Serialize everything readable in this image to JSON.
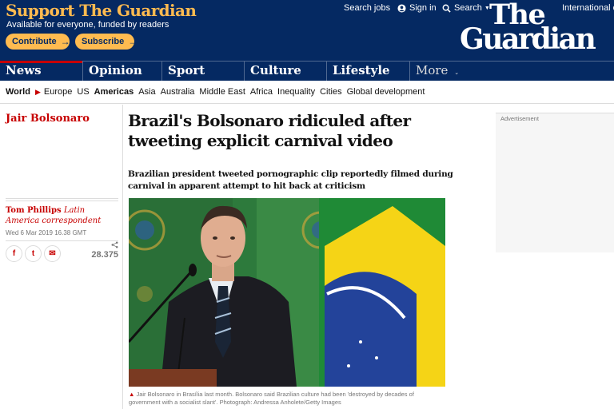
{
  "banner": {
    "title": "Support The Guardian",
    "subtitle": "Available for everyone, funded by readers",
    "contribute_label": "Contribute",
    "subscribe_label": "Subscribe",
    "arrow": "→"
  },
  "toplinks": {
    "jobs": "Search jobs",
    "signin": "Sign in",
    "search": "Search",
    "edition": "International e"
  },
  "logo": {
    "line1": "The",
    "line2": "Guardian"
  },
  "pillars": [
    "News",
    "Opinion",
    "Sport",
    "Culture",
    "Lifestyle",
    "More"
  ],
  "subnav": [
    "World",
    "Europe",
    "US",
    "Americas",
    "Asia",
    "Australia",
    "Middle East",
    "Africa",
    "Inequality",
    "Cities",
    "Global development"
  ],
  "article": {
    "series": "Jair Bolsonaro",
    "author_name": "Tom Phillips",
    "author_role": "Latin America correspondent",
    "date": "Wed 6 Mar 2019 16.38 GMT",
    "share_count": "28.375",
    "headline": "Brazil's Bolsonaro ridiculed after tweeting explicit carnival video",
    "standfirst": "Brazilian president tweeted pornographic clip reportedly filmed during carnival in apparent attempt to hit back at criticism",
    "caption": "Jair Bolsonaro in Brasília last month. Bolsonaro said Brazilian culture had been 'destroyed by decades of government with a socialist slant'. Photograph: Andressa Anholete/Getty Images"
  },
  "social": {
    "facebook": "f",
    "twitter": "t",
    "email": "✉"
  },
  "ad": {
    "label": "Advertisement"
  },
  "icons": {
    "user": "user-icon",
    "search": "search-icon",
    "share": "share-icon",
    "facebook": "facebook-icon",
    "twitter": "twitter-icon",
    "email": "email-icon"
  },
  "colors": {
    "brand_blue": "#052962",
    "accent_yellow": "#ffbb50",
    "news_red": "#c70000"
  }
}
